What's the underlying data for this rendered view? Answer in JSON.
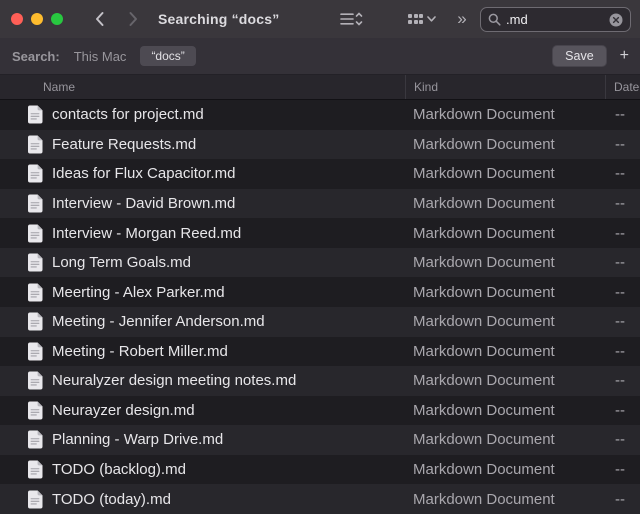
{
  "window": {
    "title": "Searching “docs”"
  },
  "toolbar": {
    "search": {
      "value": ".md"
    },
    "more_glyph": "»"
  },
  "filter_bar": {
    "label": "Search:",
    "scope_this_mac": "This Mac",
    "scope_token": "“docs”",
    "save_label": "Save",
    "add_label": "+"
  },
  "columns": {
    "name": "Name",
    "kind": "Kind",
    "date": "Date"
  },
  "files": [
    {
      "name": "contacts for project.md",
      "kind": "Markdown Document",
      "date": "--"
    },
    {
      "name": "Feature Requests.md",
      "kind": "Markdown Document",
      "date": "--"
    },
    {
      "name": "Ideas for Flux Capacitor.md",
      "kind": "Markdown Document",
      "date": "--"
    },
    {
      "name": "Interview - David Brown.md",
      "kind": "Markdown Document",
      "date": "--"
    },
    {
      "name": "Interview - Morgan Reed.md",
      "kind": "Markdown Document",
      "date": "--"
    },
    {
      "name": "Long Term Goals.md",
      "kind": "Markdown Document",
      "date": "--"
    },
    {
      "name": "Meerting - Alex Parker.md",
      "kind": "Markdown Document",
      "date": "--"
    },
    {
      "name": "Meeting - Jennifer Anderson.md",
      "kind": "Markdown Document",
      "date": "--"
    },
    {
      "name": "Meeting - Robert Miller.md",
      "kind": "Markdown Document",
      "date": "--"
    },
    {
      "name": "Neuralyzer design meeting notes.md",
      "kind": "Markdown Document",
      "date": "--"
    },
    {
      "name": "Neurayzer design.md",
      "kind": "Markdown Document",
      "date": "--"
    },
    {
      "name": "Planning - Warp Drive.md",
      "kind": "Markdown Document",
      "date": "--"
    },
    {
      "name": "TODO (backlog).md",
      "kind": "Markdown Document",
      "date": "--"
    },
    {
      "name": "TODO (today).md",
      "kind": "Markdown Document",
      "date": "--"
    }
  ]
}
